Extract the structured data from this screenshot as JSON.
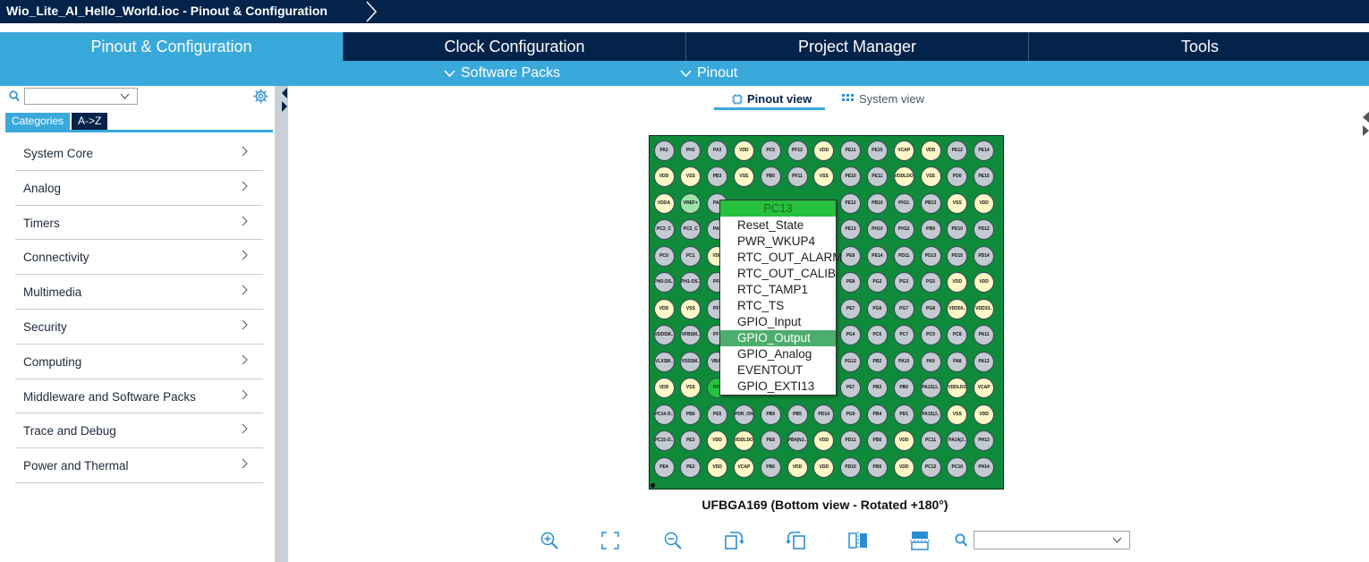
{
  "window": {
    "title": "Wio_Lite_AI_Hello_World.ioc - Pinout & Configuration"
  },
  "main_tabs": [
    {
      "label": "Pinout & Configuration",
      "active": true
    },
    {
      "label": "Clock Configuration",
      "active": false
    },
    {
      "label": "Project Manager",
      "active": false
    },
    {
      "label": "Tools",
      "active": false
    }
  ],
  "sub_menu": {
    "software_packs": "Software Packs",
    "pinout": "Pinout"
  },
  "left_panel": {
    "category_tabs": [
      "Categories",
      "A->Z"
    ],
    "categories": [
      "System Core",
      "Analog",
      "Timers",
      "Connectivity",
      "Multimedia",
      "Security",
      "Computing",
      "Middleware and Software Packs",
      "Trace and Debug",
      "Power and Thermal"
    ]
  },
  "view_tabs": {
    "pinout_view": "Pinout view",
    "system_view": "System view"
  },
  "chip": {
    "package_label": "UFBGA169 (Bottom view - Rotated  +180°)",
    "rows": [
      [
        "PA2",
        "PH2",
        "PA3",
        "VDD",
        "PC5",
        "PF12",
        "VDD",
        "PE11",
        "PE15",
        "VCAP",
        "VDD",
        "PE12",
        "PE14"
      ],
      [
        "VDD",
        "VSS",
        "PB3",
        "VSS",
        "PB0",
        "PF11",
        "VSS",
        "PE10",
        "PE11",
        "VDDLDO",
        "VSS",
        "PD0",
        "PE15"
      ],
      [
        "VDDA",
        "VREF+",
        "PA4",
        "",
        "",
        "",
        "",
        "PE12",
        "PB10",
        "PH11",
        "PB13",
        "VSS",
        "VDD"
      ],
      [
        "PC3_C",
        "PC2_C",
        "PA6",
        "",
        "",
        "",
        "",
        "PE13",
        "PH10",
        "PH12",
        "PB9",
        "PD10",
        "PD12"
      ],
      [
        "PC0",
        "PC1",
        "VDD",
        "",
        "",
        "",
        "",
        "PE9",
        "PE14",
        "PD11",
        "PD13",
        "PD15",
        "PD14"
      ],
      [
        "PH0-OS..",
        "PH1-OS..",
        "PF8",
        "",
        "",
        "",
        "",
        "PE8",
        "PG2",
        "PG3",
        "PG5",
        "VDD",
        "VDD"
      ],
      [
        "VDD",
        "VSS",
        "PF9",
        "",
        "",
        "",
        "",
        "PE7",
        "PG6",
        "PG7",
        "PG8",
        "VDD50..",
        "VDD33.."
      ],
      [
        "VDDSM..",
        "VFBSM..",
        "PF7",
        "",
        "",
        "",
        "",
        "PG4",
        "PC6",
        "PC7",
        "PC9",
        "PC8",
        "PA11"
      ],
      [
        "VLXSM..",
        "VSSSM..",
        "VBAT",
        "",
        "",
        "",
        "",
        "PG12",
        "PB2",
        "PA10",
        "PA9",
        "PA8",
        "PA12"
      ],
      [
        "VDD",
        "VSS",
        "OFF",
        "",
        "",
        "",
        "",
        "PE7",
        "PB3",
        "PB0",
        "PA13(J..",
        "VDDLDO",
        "VCAP"
      ],
      [
        "PC14-O..",
        "PB6",
        "PE5",
        "PDR_ON",
        "PB9",
        "PB5",
        "PD14",
        "PG9",
        "PB4",
        "PD1",
        "PA15(J..",
        "VSS",
        "VDD"
      ],
      [
        "PC15-O..",
        "PE3",
        "VDD",
        "VDDLDO",
        "PE8",
        "PB4(NJ..",
        "VDD",
        "PD11",
        "PB6",
        "VDD",
        "PC11",
        "PA14(J..",
        "PH13"
      ],
      [
        "PE4",
        "PE2",
        "VDD",
        "VCAP",
        "PB6",
        "VDD",
        "VDD",
        "PD10",
        "PB5",
        "VDD",
        "PC12",
        "PC10",
        "PH14"
      ]
    ]
  },
  "popup_menu": {
    "header": "PC13",
    "items": [
      "Reset_State",
      "PWR_WKUP4",
      "RTC_OUT_ALARM",
      "RTC_OUT_CALIB",
      "RTC_TAMP1",
      "RTC_TS",
      "GPIO_Input",
      "GPIO_Output",
      "GPIO_Analog",
      "EVENTOUT",
      "GPIO_EXTI13"
    ],
    "highlighted": "GPIO_Output"
  },
  "bottom_toolbar": {
    "icons": [
      "zoom-in-icon",
      "fit-screen-icon",
      "zoom-out-icon",
      "rotate-right-icon",
      "rotate-left-icon",
      "flip-vertical-icon",
      "flip-horizontal-icon",
      "search-icon"
    ]
  },
  "colors": {
    "dark_navy": "#03234b",
    "accent_blue": "#39a9dc",
    "chip_green": "#0f8a3a",
    "pin_gray": "#c4cad1",
    "pin_power": "#fff7c6",
    "pin_active": "#26c13d",
    "menu_highlight": "#4cae6c"
  }
}
